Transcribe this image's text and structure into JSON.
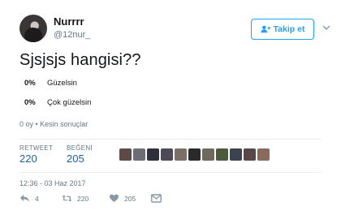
{
  "profile": {
    "name": "Nurrrr",
    "handle": "@12nur_"
  },
  "follow_button": {
    "label": "Takip et",
    "icon": "add-user-icon"
  },
  "tweet": {
    "text": "Sjsjsjs hangisi??"
  },
  "poll": {
    "options": [
      {
        "percent": "0%",
        "label": "Güzelsin"
      },
      {
        "percent": "0%",
        "label": "Çok güzelsin"
      }
    ],
    "meta": "0 oy • Kesin sonuçlar"
  },
  "stats": {
    "retweets_label": "RETWEET",
    "retweets": "220",
    "likes_label": "BEĞENİ",
    "likes": "205"
  },
  "likers_colors": [
    "#5b4a46",
    "#6b6e74",
    "#2f2f3a",
    "#4e4a55",
    "#7b6f67",
    "#2a2a2a",
    "#6f6a5e",
    "#4b5a3e",
    "#3b4250",
    "#57464a",
    "#8a6a5a"
  ],
  "timestamp": "12:36 - 03 Haz 2017",
  "actions": {
    "reply_count": "4",
    "retweet_count": "220",
    "like_count": "205"
  },
  "colors": {
    "accent": "#1da1f2",
    "stat_value": "#1b5f9c",
    "muted": "#657786"
  }
}
